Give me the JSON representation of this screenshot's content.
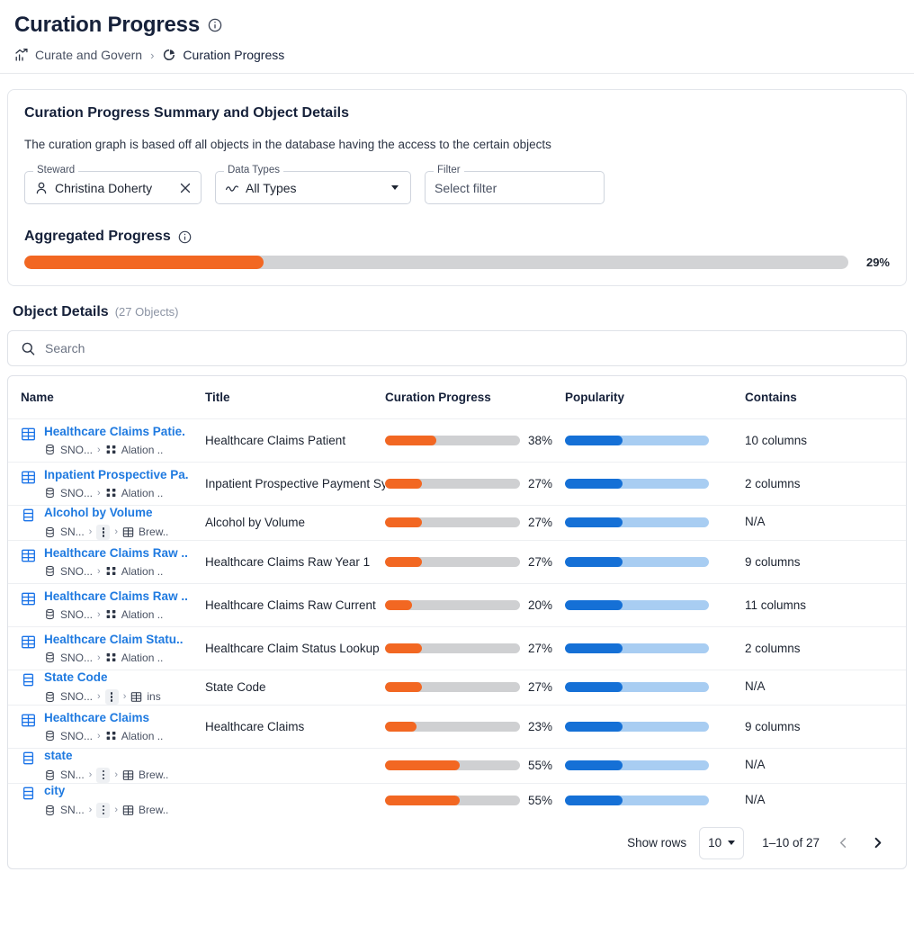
{
  "header": {
    "title": "Curation Progress",
    "info_icon": "info-icon",
    "breadcrumb": [
      {
        "label": "Curate and Govern",
        "icon": "trending-bar-chart-icon"
      },
      {
        "label": "Curation Progress",
        "icon": "pie-chart-icon"
      }
    ],
    "separator": "›"
  },
  "summary": {
    "title": "Curation Progress Summary and Object Details",
    "description": "The curation graph is based off all objects in the database having the access to the certain objects",
    "filters": [
      {
        "legend": "Steward",
        "value": "Christina Doherty",
        "lead_icon": "person-icon",
        "trail_icon": "clear-x-icon"
      },
      {
        "legend": "Data Types",
        "value": "All Types",
        "lead_icon": "wave-icon",
        "trail_icon": "chevron-down-icon"
      },
      {
        "legend": "Filter",
        "placeholder": "Select filter",
        "lead_icon": "",
        "trail_icon": ""
      }
    ],
    "aggregated": {
      "label": "Aggregated Progress",
      "info_icon": "info-icon",
      "percent": 29,
      "percent_label": "29%",
      "fill_color": "#f26722",
      "track_color": "#d2d3d5"
    }
  },
  "object_details": {
    "title": "Object Details",
    "count_label": "(27 Objects)",
    "search": {
      "placeholder": "Search",
      "icon": "search-icon"
    },
    "columns": [
      "Name",
      "Title",
      "Curation Progress",
      "Popularity",
      "Contains"
    ],
    "rows": [
      {
        "icon": "table-icon",
        "name": "Healthcare Claims Patie.",
        "title": "Healthcare Claims Patient",
        "path": [
          {
            "icon": "database-icon",
            "text": "SNO..."
          },
          {
            "icon": "schema-icon",
            "text": "Alation .."
          }
        ],
        "progress": 38,
        "progress_label": "38%",
        "popularity": 40,
        "contains": "10 columns",
        "type": "table"
      },
      {
        "icon": "table-icon",
        "name": "Inpatient Prospective Pa.",
        "title": "Inpatient Prospective Payment System",
        "path": [
          {
            "icon": "database-icon",
            "text": "SNO..."
          },
          {
            "icon": "schema-icon",
            "text": "Alation .."
          }
        ],
        "progress": 27,
        "progress_label": "27%",
        "popularity": 40,
        "contains": "2 columns",
        "type": "table"
      },
      {
        "icon": "column-icon",
        "name": "Alcohol by Volume",
        "title": "Alcohol by Volume",
        "path": [
          {
            "icon": "database-icon",
            "text": "SN..."
          },
          {
            "icon": "kebab-icon",
            "text": ""
          },
          {
            "icon": "table-icon",
            "text": "Brew.."
          }
        ],
        "progress": 27,
        "progress_label": "27%",
        "popularity": 40,
        "contains": "N/A",
        "type": "column"
      },
      {
        "icon": "table-icon",
        "name": "Healthcare Claims Raw ..",
        "title": "Healthcare Claims Raw Year 1",
        "path": [
          {
            "icon": "database-icon",
            "text": "SNO..."
          },
          {
            "icon": "schema-icon",
            "text": "Alation .."
          }
        ],
        "progress": 27,
        "progress_label": "27%",
        "popularity": 40,
        "contains": "9 columns",
        "type": "table"
      },
      {
        "icon": "table-icon",
        "name": "Healthcare Claims Raw ..",
        "title": "Healthcare Claims Raw Current",
        "path": [
          {
            "icon": "database-icon",
            "text": "SNO..."
          },
          {
            "icon": "schema-icon",
            "text": "Alation .."
          }
        ],
        "progress": 20,
        "progress_label": "20%",
        "popularity": 40,
        "contains": "11 columns",
        "type": "table"
      },
      {
        "icon": "table-icon",
        "name": "Healthcare Claim Statu..",
        "title": "Healthcare Claim Status Lookup",
        "path": [
          {
            "icon": "database-icon",
            "text": "SNO..."
          },
          {
            "icon": "schema-icon",
            "text": "Alation .."
          }
        ],
        "progress": 27,
        "progress_label": "27%",
        "popularity": 40,
        "contains": "2 columns",
        "type": "table"
      },
      {
        "icon": "column-icon",
        "name": "State Code",
        "title": "State Code",
        "path": [
          {
            "icon": "database-icon",
            "text": "SNO..."
          },
          {
            "icon": "kebab-icon",
            "text": ""
          },
          {
            "icon": "table-icon",
            "text": "ins"
          }
        ],
        "progress": 27,
        "progress_label": "27%",
        "popularity": 40,
        "contains": "N/A",
        "type": "column"
      },
      {
        "icon": "table-icon",
        "name": "Healthcare Claims",
        "title": "Healthcare Claims",
        "path": [
          {
            "icon": "database-icon",
            "text": "SNO..."
          },
          {
            "icon": "schema-icon",
            "text": "Alation .."
          }
        ],
        "progress": 23,
        "progress_label": "23%",
        "popularity": 40,
        "contains": "9 columns",
        "type": "table"
      },
      {
        "icon": "column-icon",
        "name": "state",
        "title": "",
        "path": [
          {
            "icon": "database-icon",
            "text": "SN..."
          },
          {
            "icon": "kebab-icon",
            "text": ""
          },
          {
            "icon": "table-icon",
            "text": "Brew.."
          }
        ],
        "progress": 55,
        "progress_label": "55%",
        "popularity": 40,
        "contains": "N/A",
        "type": "column"
      },
      {
        "icon": "column-icon",
        "name": "city",
        "title": "",
        "path": [
          {
            "icon": "database-icon",
            "text": "SN..."
          },
          {
            "icon": "kebab-icon",
            "text": ""
          },
          {
            "icon": "table-icon",
            "text": "Brew.."
          }
        ],
        "progress": 55,
        "progress_label": "55%",
        "popularity": 40,
        "contains": "N/A",
        "type": "column"
      }
    ],
    "footer": {
      "show_rows_label": "Show rows",
      "rows_per_page": "10",
      "range_label": "1–10 of 27",
      "prev_icon": "chevron-left-icon",
      "next_icon": "chevron-right-icon"
    }
  },
  "colors": {
    "progress_fill": "#f26722",
    "progress_track": "#cfd0d2",
    "popularity_fill": "#1570d6",
    "popularity_track": "#a8cdf2",
    "link": "#1f7ae0"
  }
}
